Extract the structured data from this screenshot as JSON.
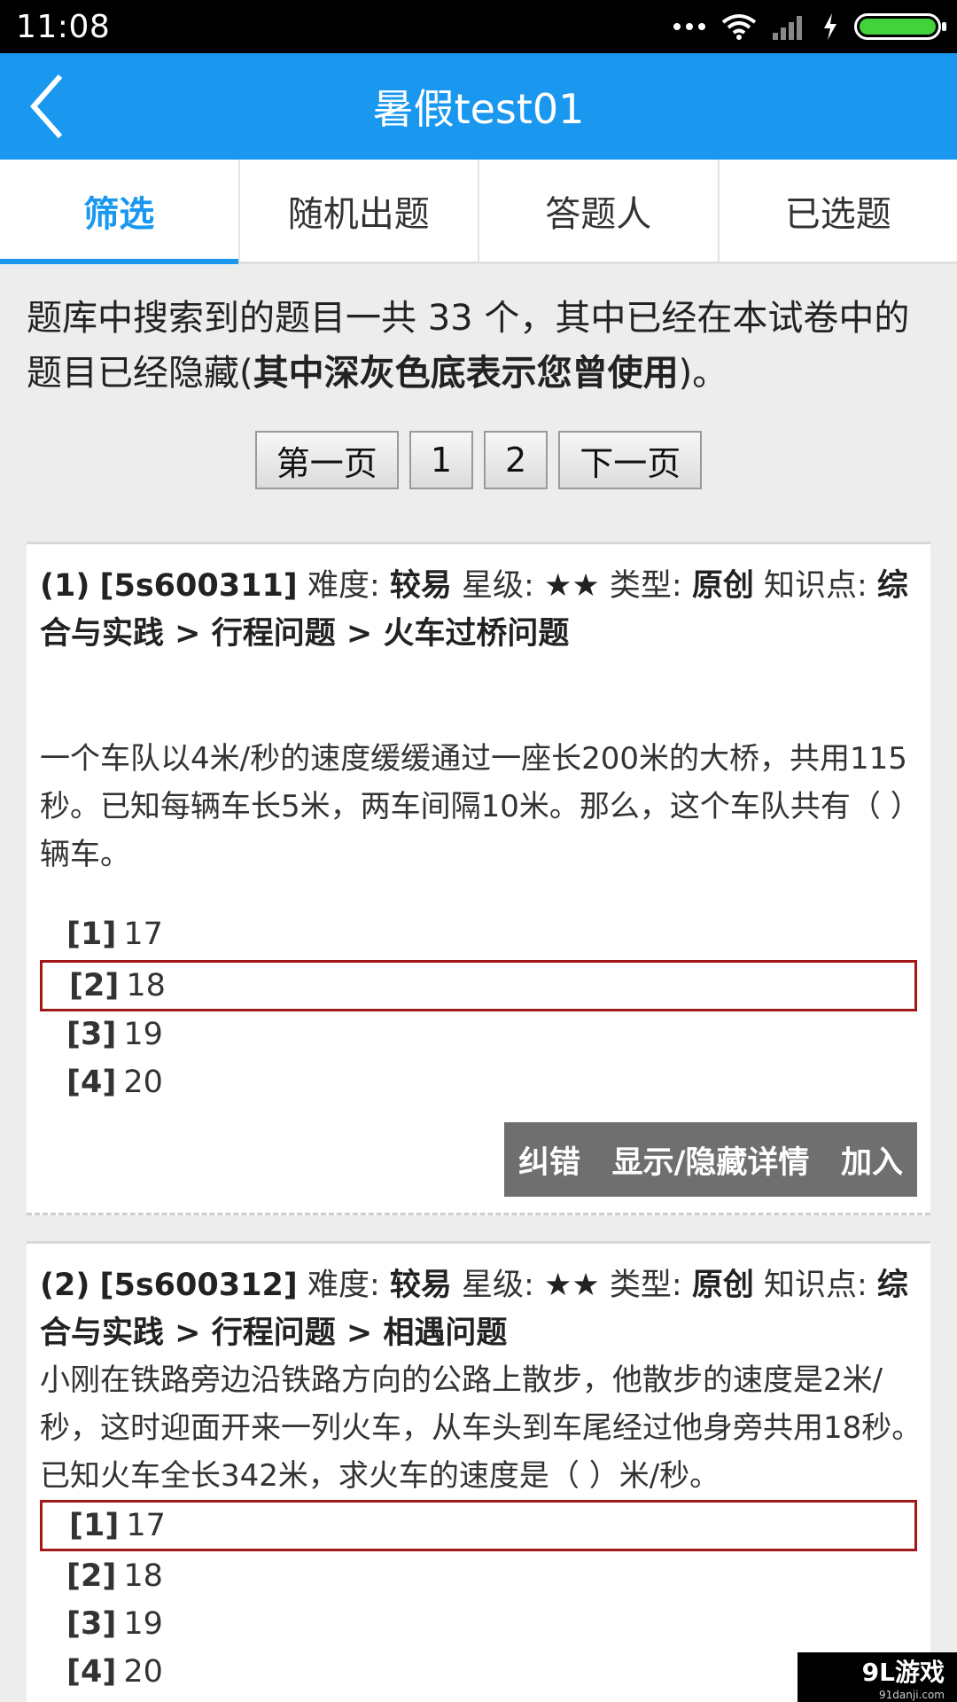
{
  "status": {
    "time": "11:08"
  },
  "header": {
    "title": "暑假test01"
  },
  "tabs": [
    {
      "label": "筛选",
      "active": true
    },
    {
      "label": "随机出题",
      "active": false
    },
    {
      "label": "答题人",
      "active": false
    },
    {
      "label": "已选题",
      "active": false
    }
  ],
  "info": {
    "text_start": "题库中搜索到的题目一共 33 个，其中已经在本试卷中的题目已经隐藏(",
    "text_bold": "其中深灰色底表示您曾使用",
    "text_end": ")。"
  },
  "pager": {
    "first": "第一页",
    "p1": "1",
    "p2": "2",
    "next": "下一页"
  },
  "labels": {
    "difficulty": "难度:",
    "stars": "星级:",
    "type": "类型:",
    "knowledge": "知识点:"
  },
  "questions": [
    {
      "index": "(1)",
      "code": "[5s600311]",
      "difficulty": "较易",
      "stars": "★★",
      "type": "原创",
      "knowledge": "综合与实践 > 行程问题 > 火车过桥问题",
      "text": "一个车队以4米/秒的速度缓缓通过一座长200米的大桥，共用115秒。已知每辆车长5米，两车间隔10米。那么，这个车队共有（ ）辆车。",
      "options": [
        {
          "no": "[1]",
          "value": "17",
          "selected": false
        },
        {
          "no": "[2]",
          "value": "18",
          "selected": true
        },
        {
          "no": "[3]",
          "value": "19",
          "selected": false
        },
        {
          "no": "[4]",
          "value": "20",
          "selected": false
        }
      ],
      "actions": {
        "report": "纠错",
        "toggle": "显示/隐藏详情",
        "add": "加入"
      }
    },
    {
      "index": "(2)",
      "code": "[5s600312]",
      "difficulty": "较易",
      "stars": "★★",
      "type": "原创",
      "knowledge": "综合与实践 > 行程问题 > 相遇问题",
      "text": "小刚在铁路旁边沿铁路方向的公路上散步，他散步的速度是2米/秒，这时迎面开来一列火车，从车头到车尾经过他身旁共用18秒。已知火车全长342米，求火车的速度是（ ）米/秒。",
      "options": [
        {
          "no": "[1]",
          "value": "17",
          "selected": true
        },
        {
          "no": "[2]",
          "value": "18",
          "selected": false
        },
        {
          "no": "[3]",
          "value": "19",
          "selected": false
        },
        {
          "no": "[4]",
          "value": "20",
          "selected": false
        }
      ]
    }
  ],
  "watermark": {
    "main": "9L游戏",
    "sub": "91danji.com"
  },
  "colors": {
    "primary": "#1a98f0",
    "selected_border": "#a01818",
    "action_bg": "#6f6f6f"
  }
}
